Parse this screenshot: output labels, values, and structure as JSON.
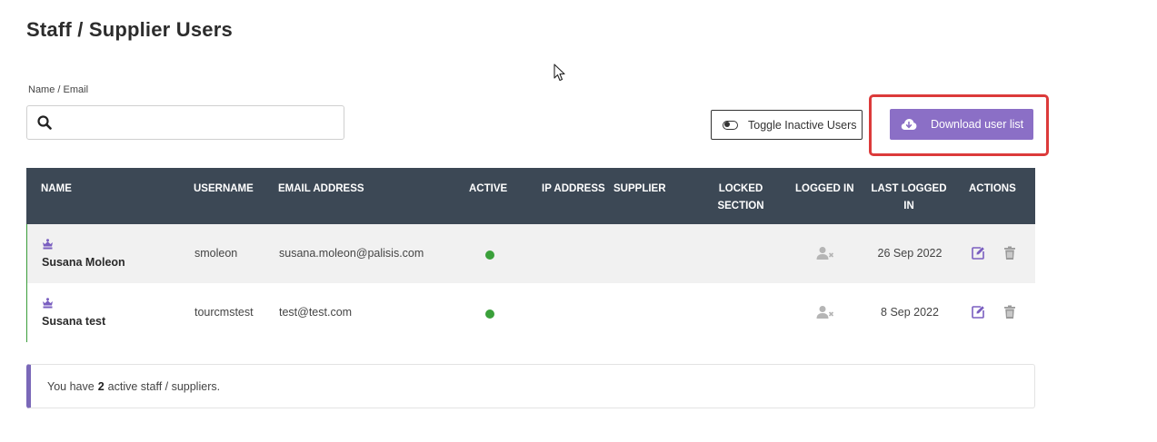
{
  "page": {
    "title": "Staff / Supplier Users"
  },
  "search": {
    "label": "Name / Email",
    "value": "",
    "placeholder": ""
  },
  "toolbar": {
    "toggle_label": "Toggle Inactive Users",
    "download_label": "Download user list"
  },
  "colors": {
    "header_bg": "#3c4855",
    "accent": "#8b6fc6",
    "active_dot": "#3aa03a",
    "highlight": "#dc3a3a"
  },
  "table": {
    "columns": {
      "name": "NAME",
      "username": "USERNAME",
      "email": "EMAIL ADDRESS",
      "active": "ACTIVE",
      "ip": "IP ADDRESS",
      "supplier": "SUPPLIER",
      "locked_1": "LOCKED",
      "locked_2": "SECTION",
      "logged_in": "LOGGED IN",
      "last_logged_1": "LAST LOGGED",
      "last_logged_2": "IN",
      "actions": "ACTIONS"
    },
    "rows": [
      {
        "name": "Susana Moleon",
        "username": "smoleon",
        "email": "susana.moleon@palisis.com",
        "active": true,
        "last_logged_in": "26 Sep 2022",
        "icon": "crown-icon"
      },
      {
        "name": "Susana test",
        "username": "tourcmstest",
        "email": "test@test.com",
        "active": true,
        "last_logged_in": "8 Sep 2022",
        "icon": "crown-icon"
      }
    ]
  },
  "summary": {
    "prefix": "You have",
    "count": "2",
    "suffix": "active staff / suppliers."
  }
}
